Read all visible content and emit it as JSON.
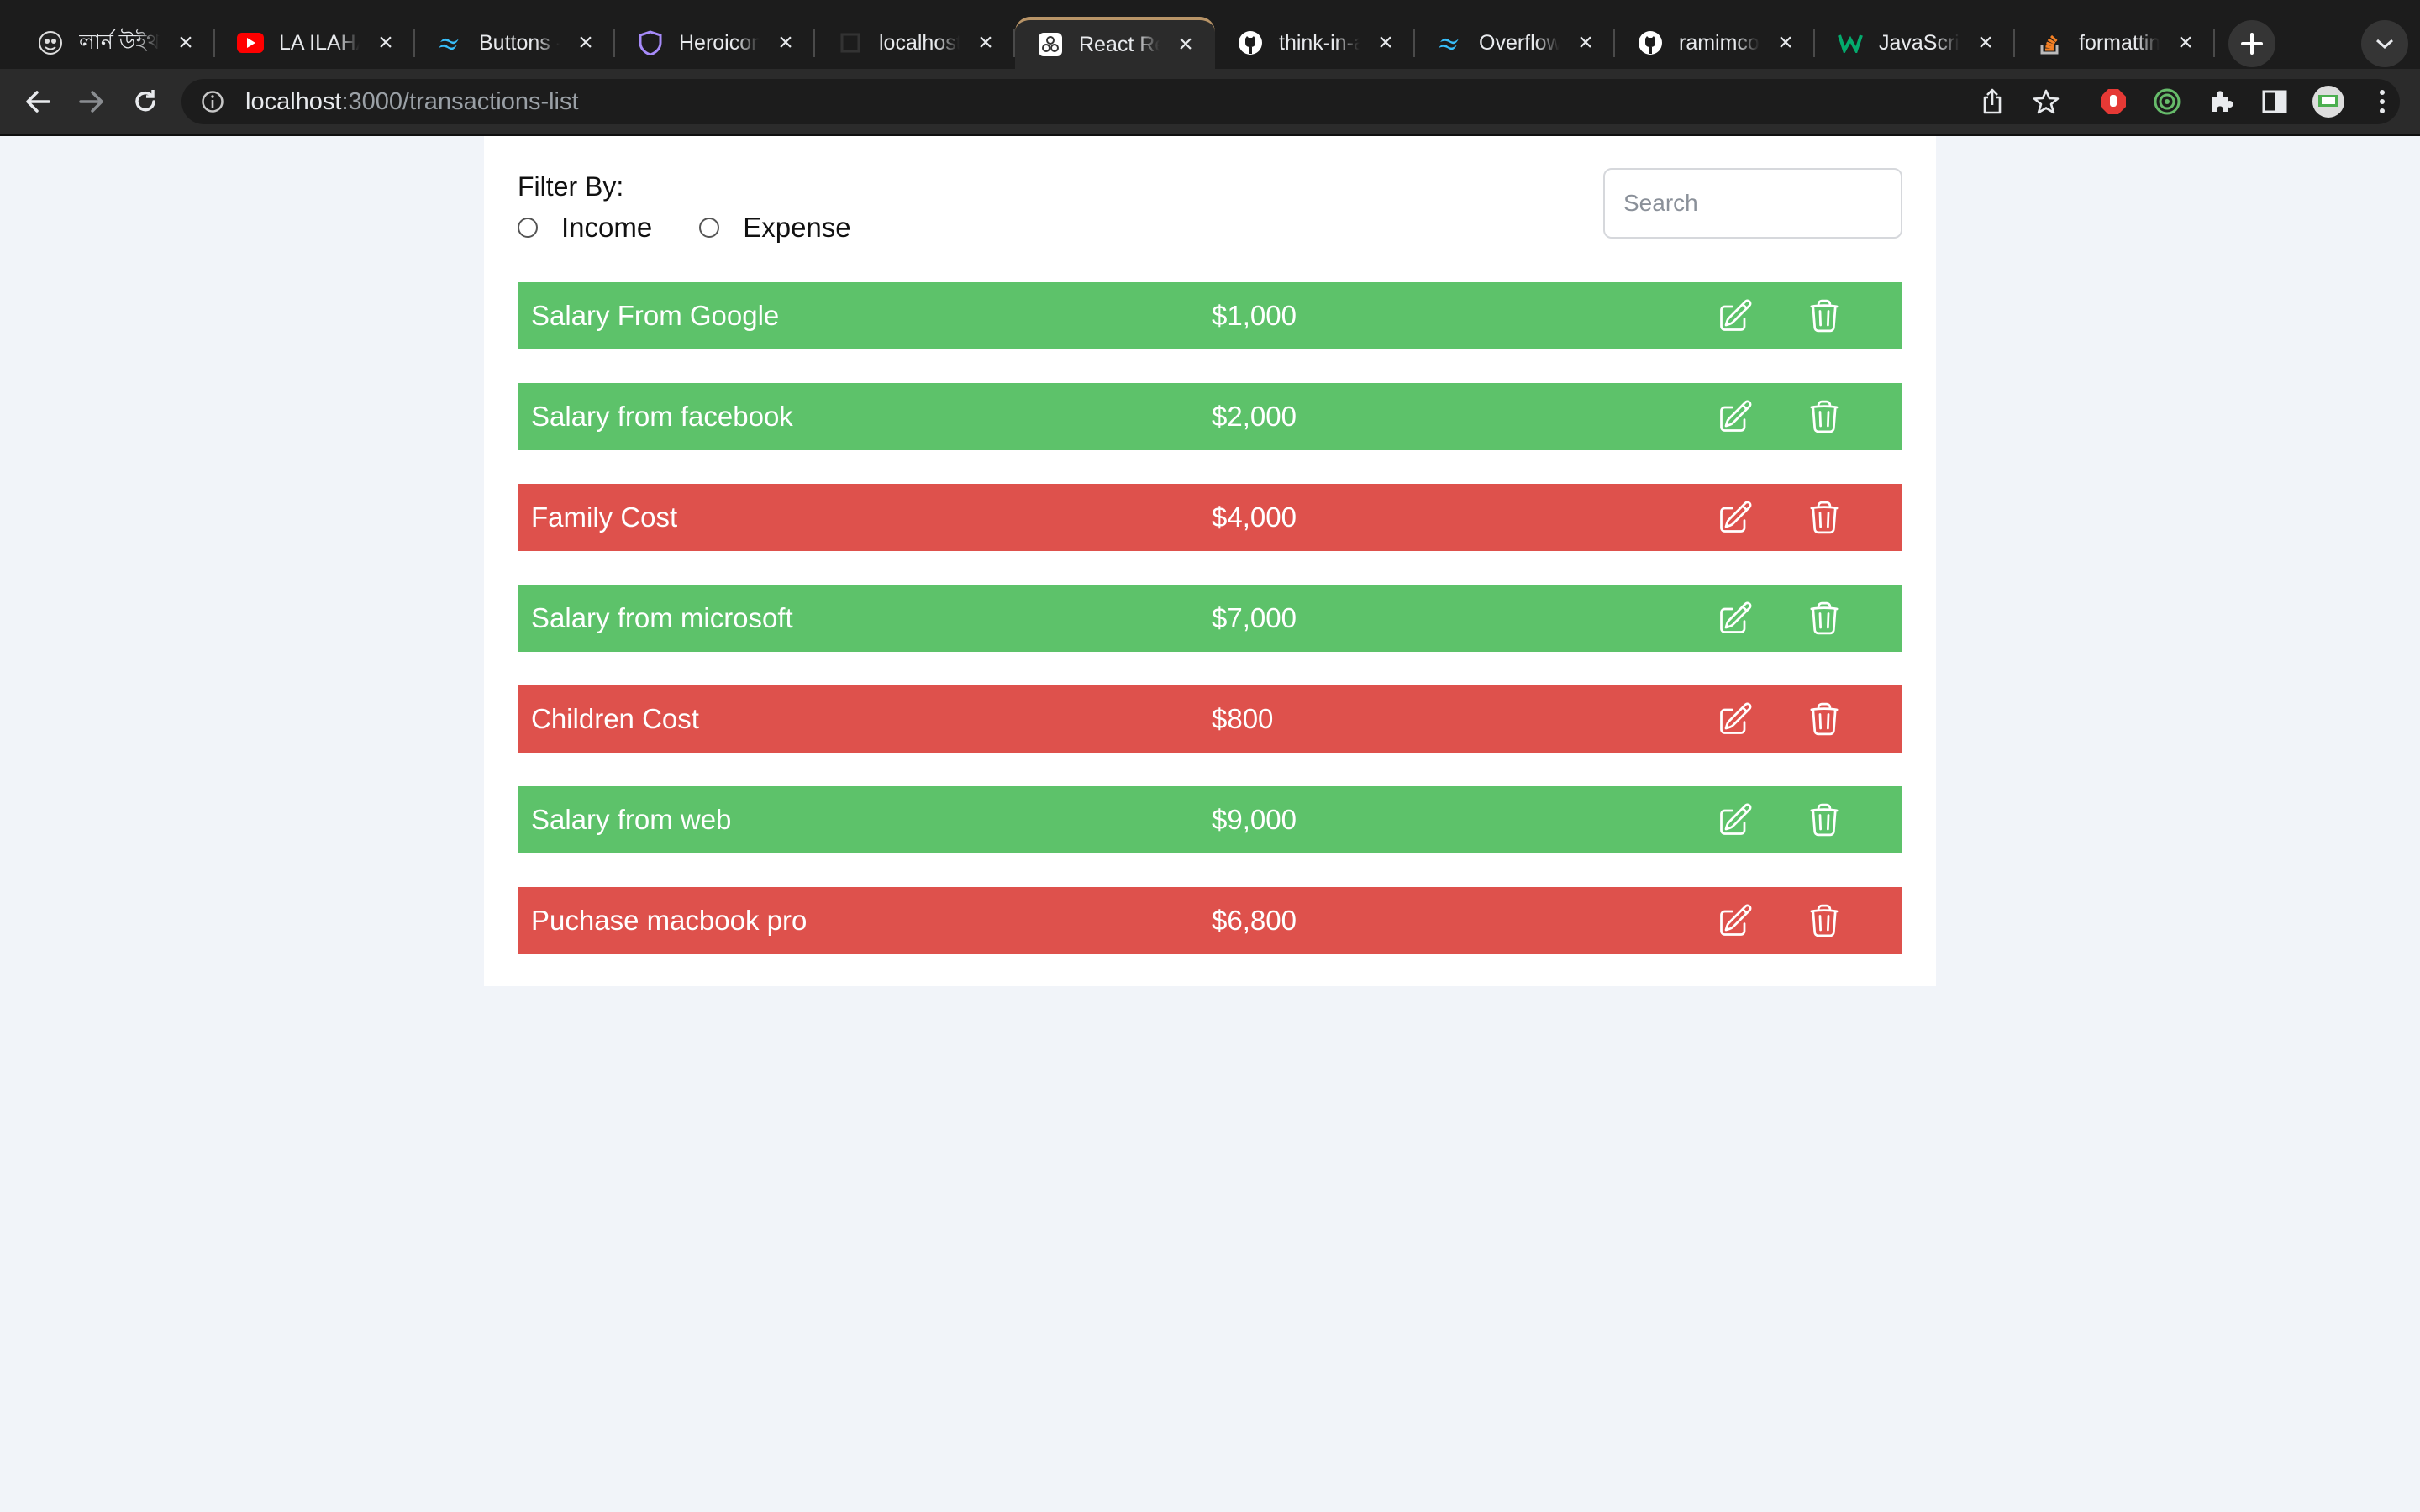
{
  "browser": {
    "tabs": [
      {
        "title": "লার্ন উইথ সু",
        "icon": "custom-icon",
        "active": false
      },
      {
        "title": "LA ILAHA",
        "icon": "youtube-icon",
        "active": false
      },
      {
        "title": "Buttons -",
        "icon": "tailwind-icon",
        "active": false
      },
      {
        "title": "Heroicons",
        "icon": "heroicons-icon",
        "active": false
      },
      {
        "title": "localhost:",
        "icon": "localhost-icon",
        "active": false
      },
      {
        "title": "React Rea",
        "icon": "react-router-icon",
        "active": true
      },
      {
        "title": "think-in-a",
        "icon": "github-icon",
        "active": false
      },
      {
        "title": "Overflow",
        "icon": "tailwind-icon",
        "active": false
      },
      {
        "title": "ramimcod",
        "icon": "github-icon",
        "active": false
      },
      {
        "title": "JavaScrip",
        "icon": "w3schools-icon",
        "active": false
      },
      {
        "title": "formatting",
        "icon": "stackoverflow-icon",
        "active": false
      }
    ],
    "url_host": "localhost",
    "url_path": ":3000/transactions-list"
  },
  "page": {
    "filter_label": "Filter By:",
    "filters": [
      {
        "label": "Income",
        "checked": false
      },
      {
        "label": "Expense",
        "checked": false
      }
    ],
    "search_placeholder": "Search",
    "search_value": ""
  },
  "transactions": [
    {
      "name": "Salary From Google",
      "amount": "$1,000",
      "type": "income"
    },
    {
      "name": "Salary from facebook",
      "amount": "$2,000",
      "type": "income"
    },
    {
      "name": "Family Cost",
      "amount": "$4,000",
      "type": "expense"
    },
    {
      "name": "Salary from microsoft",
      "amount": "$7,000",
      "type": "income"
    },
    {
      "name": "Children Cost",
      "amount": "$800",
      "type": "expense"
    },
    {
      "name": "Salary from web",
      "amount": "$9,000",
      "type": "income"
    },
    {
      "name": "Puchase macbook pro",
      "amount": "$6,800",
      "type": "expense"
    }
  ],
  "colors": {
    "income": "#5dc26a",
    "expense": "#de514c",
    "page_background": "#f1f4f9"
  }
}
